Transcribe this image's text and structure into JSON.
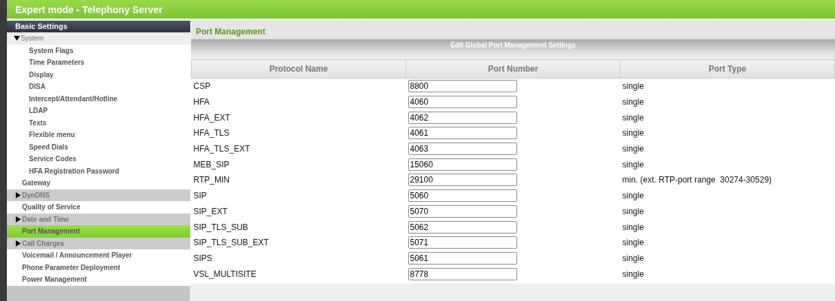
{
  "window": {
    "title": "Expert mode - Telephony Server"
  },
  "sidebar": {
    "header": "Basic Settings",
    "items": [
      {
        "label": "System",
        "kind": "group",
        "expanded": true,
        "selected": false,
        "children": [
          {
            "label": "System Flags",
            "kind": "page",
            "selected": false
          },
          {
            "label": "Time Parameters",
            "kind": "page",
            "selected": false
          },
          {
            "label": "Display",
            "kind": "page",
            "selected": false
          },
          {
            "label": "DISA",
            "kind": "page",
            "selected": false
          },
          {
            "label": "Intercept/Attendant/Hotline",
            "kind": "page",
            "selected": false
          },
          {
            "label": "LDAP",
            "kind": "page",
            "selected": false
          },
          {
            "label": "Texts",
            "kind": "page",
            "selected": false
          },
          {
            "label": "Flexible menu",
            "kind": "page",
            "selected": false
          },
          {
            "label": "Speed Dials",
            "kind": "page",
            "selected": false
          },
          {
            "label": "Service Codes",
            "kind": "page",
            "selected": false
          },
          {
            "label": "HFA Registration Password",
            "kind": "page",
            "selected": false
          }
        ]
      },
      {
        "label": "Gateway",
        "kind": "page",
        "selected": false
      },
      {
        "label": "DynDNS",
        "kind": "group",
        "expanded": false,
        "selected": false
      },
      {
        "label": "Quality of Service",
        "kind": "page",
        "selected": false
      },
      {
        "label": "Date and Time",
        "kind": "group",
        "expanded": false,
        "selected": false
      },
      {
        "label": "Port Management",
        "kind": "page",
        "selected": true
      },
      {
        "label": "Call Charges",
        "kind": "group",
        "expanded": false,
        "selected": false
      },
      {
        "label": "Voicemail / Announcement Player",
        "kind": "page",
        "selected": false
      },
      {
        "label": "Phone Parameter Deployment",
        "kind": "page",
        "selected": false
      },
      {
        "label": "Power Management",
        "kind": "page",
        "selected": false
      }
    ]
  },
  "page": {
    "title": "Port Management",
    "section": "Edit Global Port Management Settings"
  },
  "table": {
    "columns": [
      "Protocol Name",
      "Port Number",
      "Port Type"
    ],
    "rows": [
      {
        "protocol": "CSP",
        "port": "8800",
        "type": "single"
      },
      {
        "protocol": "HFA",
        "port": "4060",
        "type": "single"
      },
      {
        "protocol": "HFA_EXT",
        "port": "4062",
        "type": "single"
      },
      {
        "protocol": "HFA_TLS",
        "port": "4061",
        "type": "single"
      },
      {
        "protocol": "HFA_TLS_EXT",
        "port": "4063",
        "type": "single"
      },
      {
        "protocol": "MEB_SIP",
        "port": "15060",
        "type": "single"
      },
      {
        "protocol": "RTP_MIN",
        "port": "29100",
        "type": "min. (ext. RTP-port range  30274-30529)"
      },
      {
        "protocol": "SIP",
        "port": "5060",
        "type": "single"
      },
      {
        "protocol": "SIP_EXT",
        "port": "5070",
        "type": "single"
      },
      {
        "protocol": "SIP_TLS_SUB",
        "port": "5062",
        "type": "single"
      },
      {
        "protocol": "SIP_TLS_SUB_EXT",
        "port": "5071",
        "type": "single"
      },
      {
        "protocol": "SIPS",
        "port": "5061",
        "type": "single"
      },
      {
        "protocol": "VSL_MULTISITE",
        "port": "8778",
        "type": "single"
      }
    ]
  }
}
